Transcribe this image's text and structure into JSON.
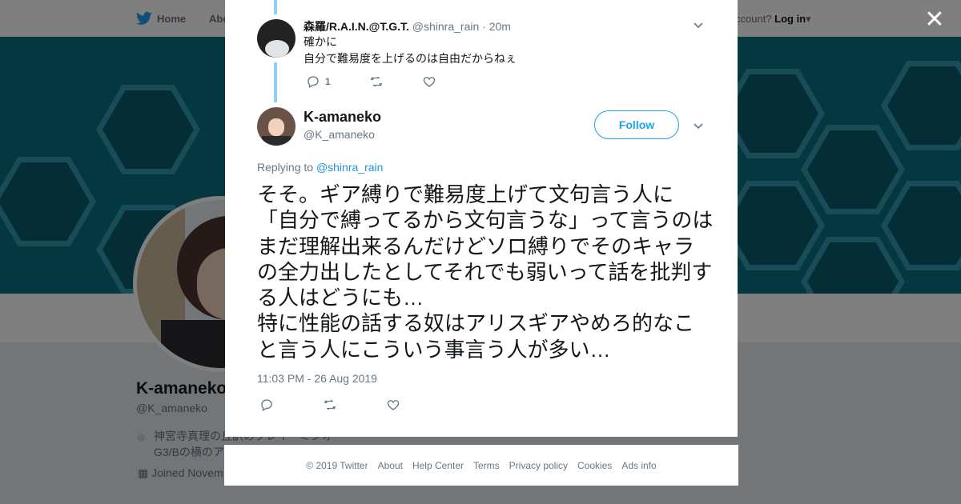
{
  "nav": {
    "home": "Home",
    "about": "Abo",
    "account_question": "ccount?",
    "login": "Log in"
  },
  "profile": {
    "name": "K-amaneko",
    "handle": "@K_amaneko",
    "location_line1": "神宮寺真理の丘訳のクレイ・ミンオ",
    "location_line2": "G3/Bの横のア",
    "joined": "Joined Novem"
  },
  "reply": {
    "name": "森羅/R.A.I.N.@T.G.T.",
    "handle": "@shinra_rain",
    "time": "· 20m",
    "line1": "確かに",
    "line2": "自分で難易度を上げるのは自由だからねぇ",
    "reply_count": "1"
  },
  "tweet": {
    "name": "K-amaneko",
    "handle": "@K_amaneko",
    "follow_label": "Follow",
    "replying_prefix": "Replying to",
    "replying_to": "@shinra_rain",
    "text": "そそ。ギア縛りで難易度上げて文句言う人に「自分で縛ってるから文句言うな」って言うのはまだ理解出来るんだけどソロ縛りでそのキャラの全力出したとしてそれでも弱いって話を批判する人はどうにも…\n特に性能の話する奴はアリスギアやめろ的なこと言う人にこういう事言う人が多い…",
    "timestamp": "11:03 PM - 26 Aug 2019"
  },
  "footer": {
    "copyright": "© 2019 Twitter",
    "about": "About",
    "help": "Help Center",
    "terms": "Terms",
    "privacy": "Privacy policy",
    "cookies": "Cookies",
    "ads": "Ads info"
  },
  "icons": {
    "reply": "reply-icon",
    "retweet": "retweet-icon",
    "like": "heart-icon",
    "caret": "chevron-down-icon",
    "close": "close-icon",
    "bird": "twitter-bird-icon"
  },
  "colors": {
    "brand": "#1da1f2",
    "link": "#1b95e0",
    "text": "#14171a",
    "muted": "#657786"
  }
}
